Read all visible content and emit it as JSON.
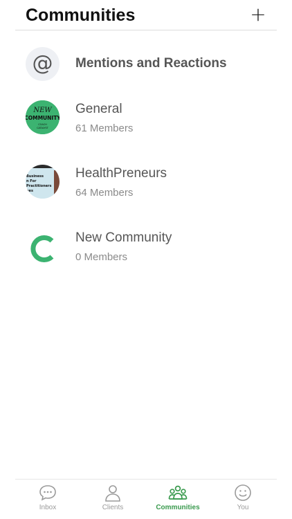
{
  "header": {
    "title": "Communities",
    "add_label": "+"
  },
  "rows": [
    {
      "title": "Mentions and Reactions",
      "icon": "at-icon",
      "glyph": "@"
    },
    {
      "title": "General",
      "members": "61 Members",
      "avatar_text": [
        "NEW",
        "COMMUNITY",
        "COACH",
        "CATALYST"
      ]
    },
    {
      "title": "HealthPreneurs",
      "members": "64 Members",
      "avatar_text": [
        "Business",
        "n For",
        "Practitioners",
        "hes"
      ]
    },
    {
      "title": "New Community",
      "members": "0 Members",
      "avatar_letter": "C"
    }
  ],
  "tabs": [
    {
      "label": "Inbox",
      "icon": "chat-bubble-icon"
    },
    {
      "label": "Clients",
      "icon": "person-icon"
    },
    {
      "label": "Communities",
      "icon": "group-icon",
      "active": true
    },
    {
      "label": "You",
      "icon": "smiley-icon"
    }
  ],
  "colors": {
    "accent": "#3a9a4e",
    "brand_green": "#3cb371"
  }
}
